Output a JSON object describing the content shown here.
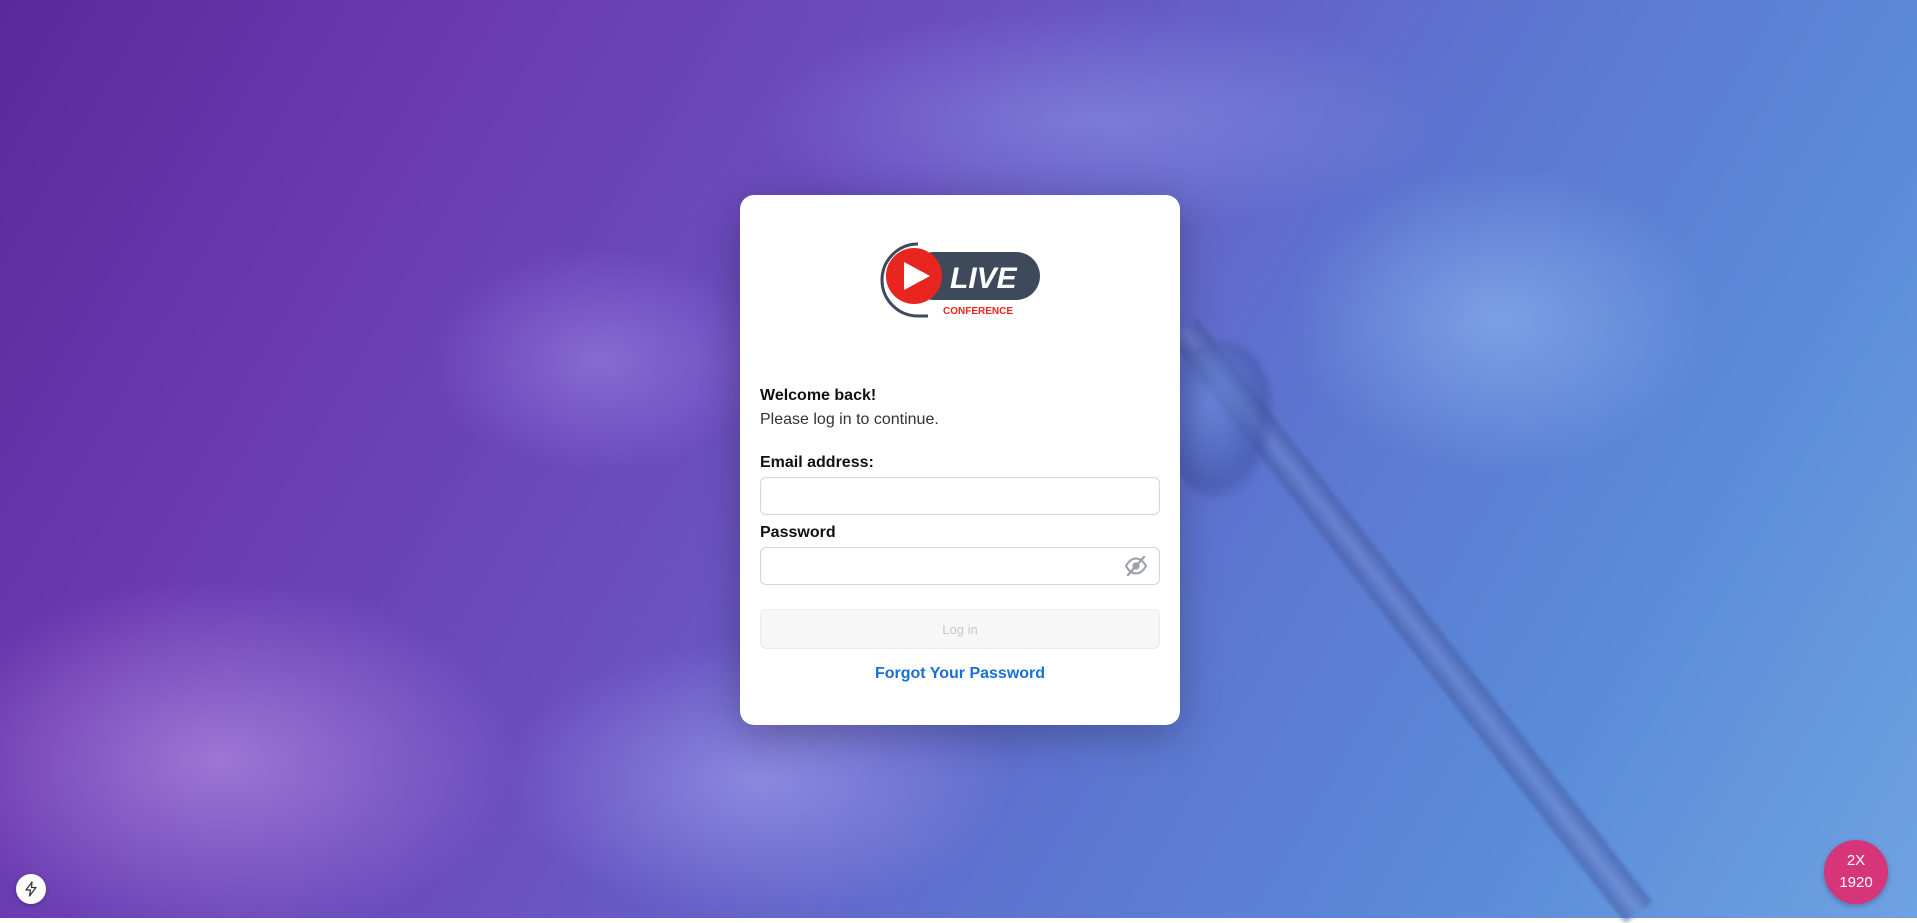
{
  "logo": {
    "text": "LIVE",
    "subtext": "CONFERENCE",
    "accent": "#e8251f",
    "dark": "#3e4a5c"
  },
  "welcome": {
    "title": "Welcome back!",
    "subtitle": "Please log in to continue."
  },
  "form": {
    "email_label": "Email address:",
    "email_value": "",
    "password_label": "Password",
    "password_value": "",
    "password_toggle_icon": "eye-off-icon",
    "login_label": "Log in",
    "forgot_label": "Forgot Your Password"
  },
  "badge": {
    "scale": "2X",
    "width": "1920",
    "color": "#d6357a"
  },
  "corner_icon": "lightning-icon",
  "colors": {
    "link": "#1a6fd6",
    "bg_start": "#5a2a9a",
    "bg_end": "#6fa2e2"
  }
}
